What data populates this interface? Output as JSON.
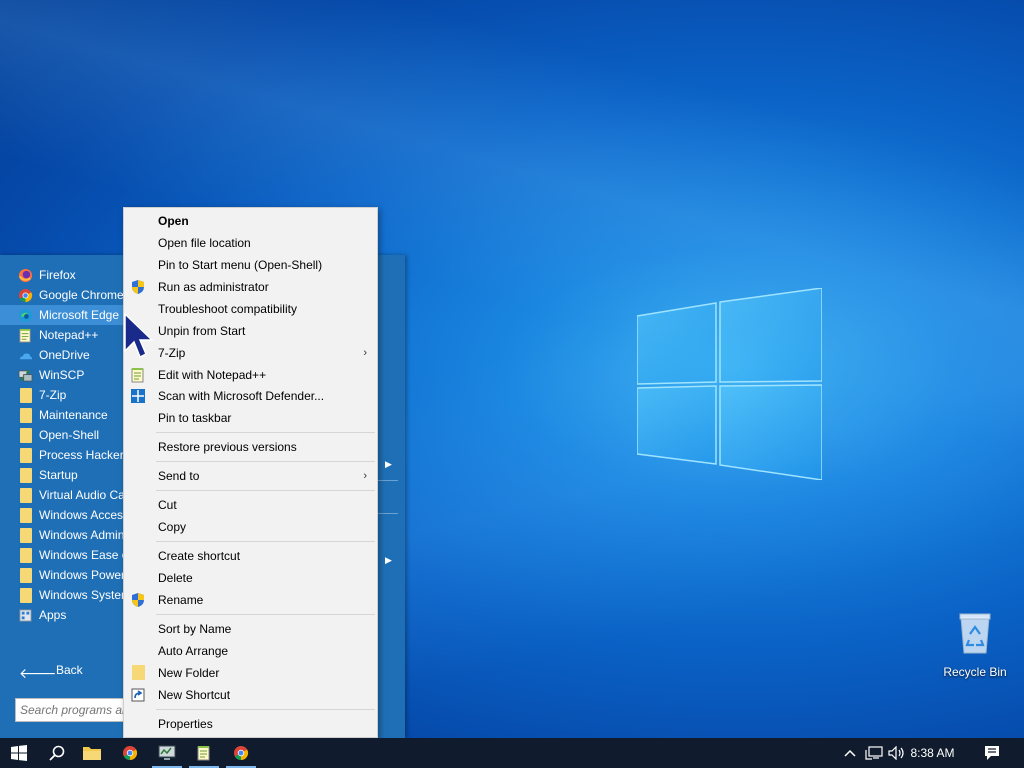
{
  "desktop": {
    "recycle_bin_label": "Recycle Bin"
  },
  "start_menu": {
    "items": [
      {
        "label": "Firefox",
        "icon": "firefox-icon"
      },
      {
        "label": "Google Chrome",
        "icon": "chrome-icon"
      },
      {
        "label": "Microsoft Edge",
        "icon": "edge-icon",
        "selected": true
      },
      {
        "label": "Notepad++",
        "icon": "notepad-plus-plus-icon"
      },
      {
        "label": "OneDrive",
        "icon": "onedrive-icon"
      },
      {
        "label": "WinSCP",
        "icon": "winscp-icon"
      },
      {
        "label": "7-Zip",
        "icon": "folder-icon"
      },
      {
        "label": "Maintenance",
        "icon": "folder-icon"
      },
      {
        "label": "Open-Shell",
        "icon": "folder-icon"
      },
      {
        "label": "Process Hacker",
        "icon": "folder-icon"
      },
      {
        "label": "Startup",
        "icon": "folder-icon"
      },
      {
        "label": "Virtual Audio Ca",
        "icon": "folder-icon"
      },
      {
        "label": "Windows Access",
        "icon": "folder-icon"
      },
      {
        "label": "Windows Admin",
        "icon": "folder-icon"
      },
      {
        "label": "Windows Ease o",
        "icon": "folder-icon"
      },
      {
        "label": "Windows Power",
        "icon": "folder-icon"
      },
      {
        "label": "Windows System",
        "icon": "folder-icon"
      },
      {
        "label": "Apps",
        "icon": "apps-icon"
      }
    ],
    "back_label": "Back",
    "search_placeholder": "Search programs and files"
  },
  "context_menu": {
    "items": [
      {
        "label": "Open",
        "bold": true
      },
      {
        "label": "Open file location"
      },
      {
        "label": "Pin to Start menu (Open-Shell)"
      },
      {
        "label": "Run as administrator",
        "icon": "shield-icon"
      },
      {
        "label": "Troubleshoot compatibility"
      },
      {
        "label": "Unpin from Start"
      },
      {
        "label": "7-Zip",
        "submenu": true
      },
      {
        "label": "Edit with Notepad++",
        "icon": "notepad-plus-plus-icon"
      },
      {
        "label": "Scan with Microsoft Defender...",
        "icon": "defender-icon"
      },
      {
        "label": "Pin to taskbar"
      },
      {
        "label": "Restore previous versions"
      },
      {
        "label": "Send to",
        "submenu": true
      },
      {
        "label": "Cut"
      },
      {
        "label": "Copy"
      },
      {
        "label": "Create shortcut"
      },
      {
        "label": "Delete"
      },
      {
        "label": "Rename",
        "icon": "shield-icon"
      },
      {
        "label": "Sort by Name"
      },
      {
        "label": "Auto Arrange"
      },
      {
        "label": "New Folder",
        "icon": "folder-icon"
      },
      {
        "label": "New Shortcut",
        "icon": "shortcut-icon"
      },
      {
        "label": "Properties"
      }
    ]
  },
  "taskbar": {
    "clock": "8:38 AM",
    "pinned": [
      "start-icon",
      "search-icon",
      "file-explorer-icon",
      "chrome-icon",
      "process-hacker-icon",
      "notepad-plus-plus-icon",
      "chrome-icon"
    ]
  }
}
